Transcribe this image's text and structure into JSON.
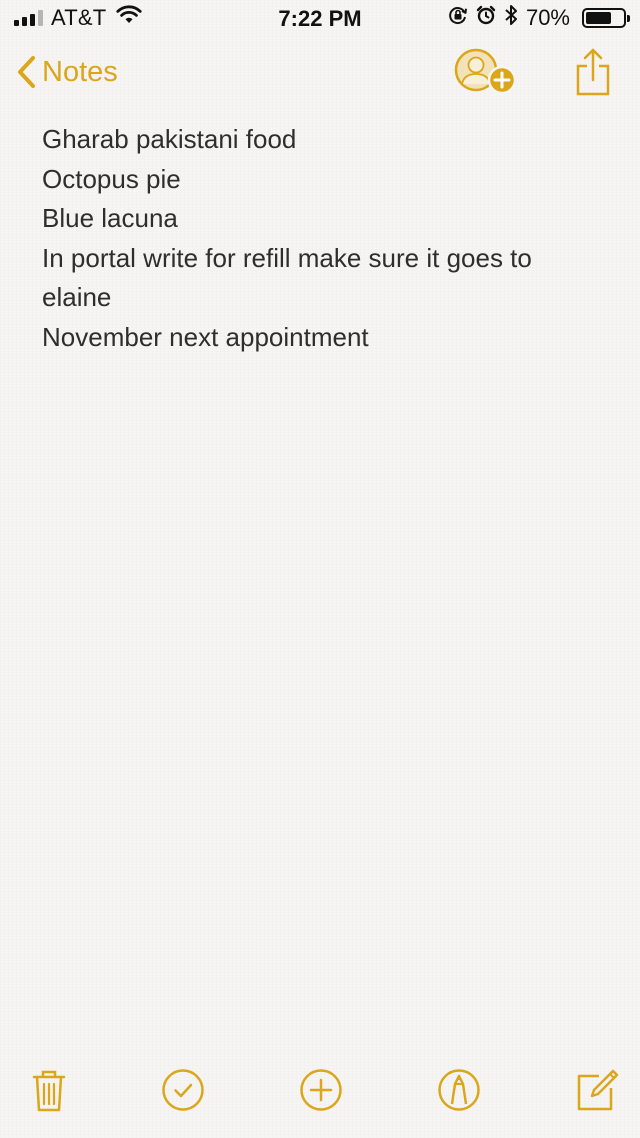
{
  "status_bar": {
    "carrier": "AT&T",
    "time": "7:22 PM",
    "battery_percent": "70%",
    "battery_level": 0.7,
    "icons": [
      "signal-icon",
      "wifi-icon",
      "rotation-lock-icon",
      "alarm-icon",
      "bluetooth-icon",
      "battery-icon"
    ]
  },
  "nav": {
    "back_label": "Notes",
    "icons": [
      "chevron-left-icon",
      "add-person-icon",
      "share-icon"
    ]
  },
  "note": {
    "lines": [
      "Gharab pakistani food",
      "Octopus pie",
      "Blue lacuna",
      "In portal write for refill make sure it goes to",
      "elaine",
      "November next appointment"
    ]
  },
  "toolbar": {
    "icons": [
      "trash-icon",
      "checklist-icon",
      "add-icon",
      "markup-icon",
      "compose-icon"
    ]
  },
  "colors": {
    "accent": "#dca61b",
    "background": "#f6f5f3",
    "text": "#2e2e2e"
  }
}
